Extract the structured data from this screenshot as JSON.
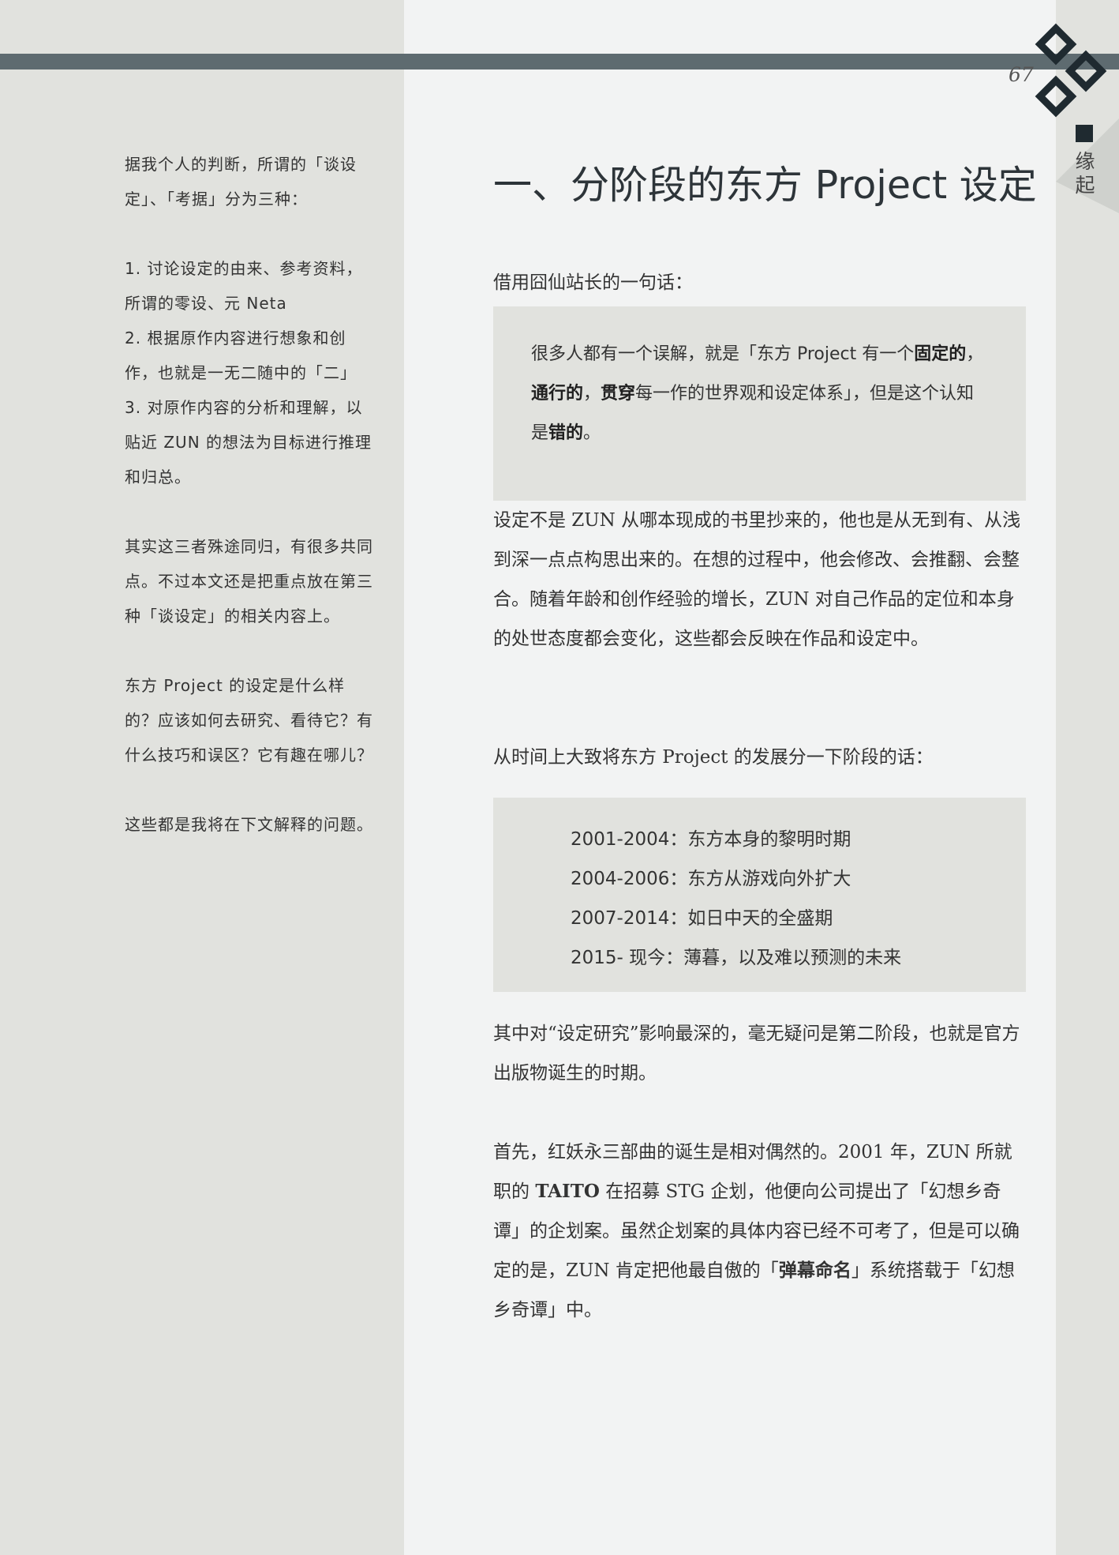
{
  "page": {
    "number": "67",
    "section_label": "缘起"
  },
  "sidebar": {
    "para1": "据我个人的判断，所谓的「谈设定」、「考据」分为三种：",
    "item1": "1. 讨论设定的由来、参考资料，所谓的零设、元 Neta",
    "item2": "2. 根据原作内容进行想象和创作，也就是一无二随中的「二」",
    "item3": "3. 对原作内容的分析和理解，以贴近 ZUN 的想法为目标进行推理和归总。",
    "para3": "其实这三者殊途同归，有很多共同点。不过本文还是把重点放在第三种「谈设定」的相关内容上。",
    "para4": "东方 Project 的设定是什么样的？应该如何去研究、看待它？有什么技巧和误区？它有趣在哪儿？",
    "para5": "这些都是我将在下文解释的问题。"
  },
  "main": {
    "title": "一、分阶段的东方 Project 设定",
    "intro": "借用囧仙站长的一句话：",
    "quote": {
      "t1": "很多人都有一个误解，就是「东方 Project 有一个",
      "b1": "固定的",
      "t2": "，",
      "b2": "通行的",
      "t3": "，",
      "b3": "贯穿",
      "t4": "每一作的世界观和设定体系」，但是这个认知是",
      "b4": "错的",
      "t5": "。"
    },
    "para1": "设定不是 ZUN 从哪本现成的书里抄来的，他也是从无到有、从浅到深一点点构思出来的。在想的过程中，他会修改、会推翻、会整合。随着年龄和创作经验的增长，ZUN 对自己作品的定位和本身的处世态度都会变化，这些都会反映在作品和设定中。",
    "para2": "从时间上大致将东方 Project 的发展分一下阶段的话：",
    "timeline": [
      "2001-2004：东方本身的黎明时期",
      "2004-2006：东方从游戏向外扩大",
      "2007-2014：如日中天的全盛期",
      "2015- 现今：薄暮，以及难以预测的未来"
    ],
    "para3": "其中对“设定研究”影响最深的，毫无疑问是第二阶段，也就是官方出版物诞生的时期。",
    "para4": {
      "t1": "首先，红妖永三部曲的诞生是相对偶然的。2001 年，ZUN 所就职的 ",
      "b1": "TAITO",
      "t2": " 在招募 STG 企划，他便向公司提出了「幻想乡奇谭」的企划案。虽然企划案的具体内容已经不可考了，但是可以确定的是，ZUN 肯定把他最自傲的「",
      "b2": "弹幕命名",
      "t3": "」系统搭载于「幻想乡奇谭」中。"
    }
  },
  "colors": {
    "band": "#5e6b70",
    "panel_gray": "#e1e2de",
    "page_light": "#f2f3f3",
    "ornament": "#1f2a30"
  },
  "icons": [
    "diamond-ornament-icon",
    "square-bullet-icon"
  ]
}
